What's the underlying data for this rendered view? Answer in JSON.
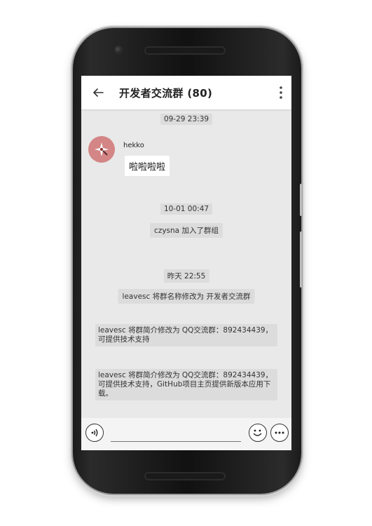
{
  "header": {
    "title": "开发者交流群 (80)",
    "back_icon": "arrow-back-icon",
    "more_icon": "overflow-menu-icon"
  },
  "messages": {
    "ts1": "09-29 23:39",
    "sender_name": "hekko",
    "bubble_text": "啦啦啦啦",
    "ts2": "10-01 00:47",
    "join_notice": "czysna  加入了群组",
    "ts3": "昨天 22:55",
    "rename_notice": "leavesc 将群名称修改为 开发者交流群",
    "intro_notice_1": "leavesc 将群简介修改为 QQ交流群：892434439，可提供技术支持",
    "intro_notice_2": "leavesc 将群简介修改为 QQ交流群：892434439，可提供技术支持，GitHub项目主页提供新版本应用下载。"
  },
  "input_bar": {
    "voice_icon": "voice-icon",
    "text_value": "",
    "emoji_icon": "emoji-icon",
    "more_icon": "more-options-icon"
  },
  "colors": {
    "avatar_bg": "#d48585",
    "chat_bg": "#e9e9e9",
    "notice_bg": "#dcdcdc"
  }
}
